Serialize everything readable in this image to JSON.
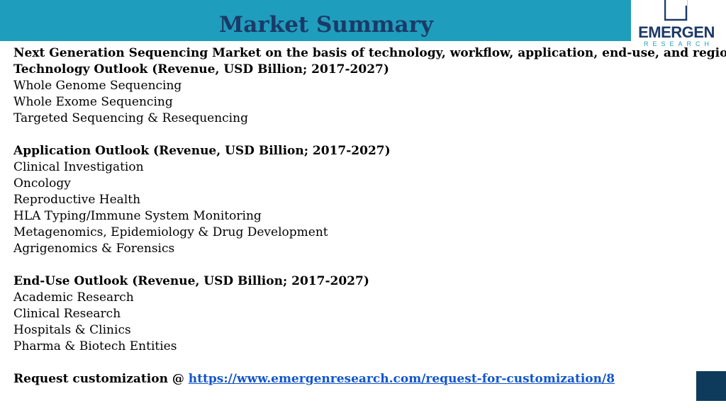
{
  "header": {
    "title": "Market Summary"
  },
  "logo": {
    "name": "EMERGEN",
    "sub": "RESEARCH"
  },
  "intro": "Next Generation Sequencing Market on the basis of technology, workflow, application, end-use, and region:",
  "technology": {
    "heading": "Technology Outlook (Revenue, USD Billion; 2017-2027)",
    "items": [
      "Whole Genome Sequencing",
      "Whole Exome Sequencing",
      "Targeted Sequencing & Resequencing"
    ]
  },
  "application": {
    "heading": "Application Outlook (Revenue, USD Billion; 2017-2027)",
    "items": [
      "Clinical Investigation",
      "Oncology",
      "Reproductive Health",
      "HLA Typing/Immune System Monitoring",
      "Metagenomics, Epidemiology & Drug Development",
      "Agrigenomics & Forensics"
    ]
  },
  "end_use": {
    "heading": "End-Use Outlook (Revenue, USD Billion; 2017-2027)",
    "items": [
      "Academic Research",
      "Clinical Research",
      "Hospitals & Clinics",
      "Pharma & Biotech Entities"
    ]
  },
  "request": {
    "label": "Request customization @ ",
    "url": "https://www.emergenresearch.com/request-for-customization/8"
  },
  "colors": {
    "header_bar": "#1f9dbc",
    "title": "#1b3a67",
    "link": "#1155cc",
    "corner_square": "#0e3b5c"
  }
}
